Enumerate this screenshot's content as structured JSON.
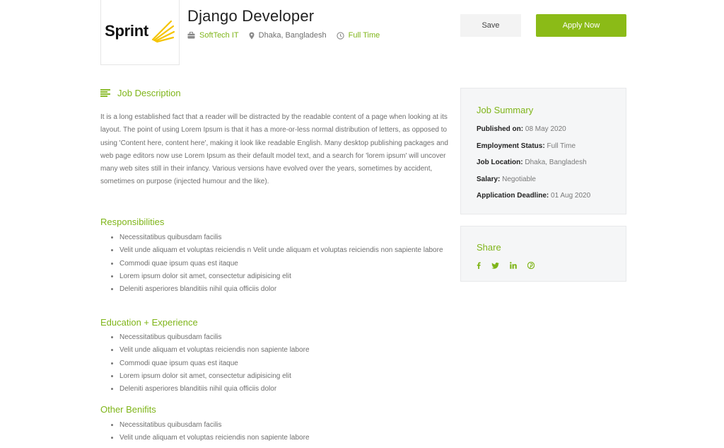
{
  "header": {
    "logo_text": "Sprint",
    "title": "Django Developer",
    "company": "SoftTech IT",
    "location": "Dhaka, Bangladesh",
    "job_type": "Full Time",
    "save_label": "Save",
    "apply_label": "Apply Now"
  },
  "description": {
    "heading": "Job Description",
    "text": "It is a long established fact that a reader will be distracted by the readable content of a page when looking at its layout. The point of using Lorem Ipsum is that it has a more-or-less normal distribution of letters, as opposed to using 'Content here, content here', making it look like readable English. Many desktop publishing packages and web page editors now use Lorem Ipsum as their default model text, and a search for 'lorem ipsum' will uncover many web sites still in their infancy. Various versions have evolved over the years, sometimes by accident, sometimes on purpose (injected humour and the like)."
  },
  "sections": {
    "responsibilities": {
      "title": "Responsibilities",
      "items": [
        "Necessitatibus quibusdam facilis",
        "Velit unde aliquam et voluptas reiciendis n Velit unde aliquam et voluptas reiciendis non sapiente labore",
        "Commodi quae ipsum quas est itaque",
        "Lorem ipsum dolor sit amet, consectetur adipisicing elit",
        "Deleniti asperiores blanditiis nihil quia officiis dolor"
      ]
    },
    "education": {
      "title": "Education + Experience",
      "items": [
        "Necessitatibus quibusdam facilis",
        "Velit unde aliquam et voluptas reiciendis non sapiente labore",
        "Commodi quae ipsum quas est itaque",
        "Lorem ipsum dolor sit amet, consectetur adipisicing elit",
        "Deleniti asperiores blanditiis nihil quia officiis dolor"
      ]
    },
    "benefits": {
      "title": "Other Benifits",
      "items": [
        "Necessitatibus quibusdam facilis",
        "Velit unde aliquam et voluptas reiciendis non sapiente labore"
      ]
    }
  },
  "summary": {
    "title": "Job Summary",
    "published_label": "Published on:",
    "published_value": "08 May 2020",
    "status_label": "Employment Status:",
    "status_value": "Full Time",
    "location_label": "Job Location:",
    "location_value": "Dhaka, Bangladesh",
    "salary_label": "Salary:",
    "salary_value": "Negotiable",
    "deadline_label": "Application Deadline:",
    "deadline_value": "01 Aug 2020"
  },
  "share": {
    "title": "Share",
    "icons": [
      "facebook-icon",
      "twitter-icon",
      "linkedin-icon",
      "pinterest-icon"
    ]
  },
  "colors": {
    "accent": "#7fb519",
    "apply_button": "#8bbb17",
    "logo_yellow": "#f5c400"
  }
}
